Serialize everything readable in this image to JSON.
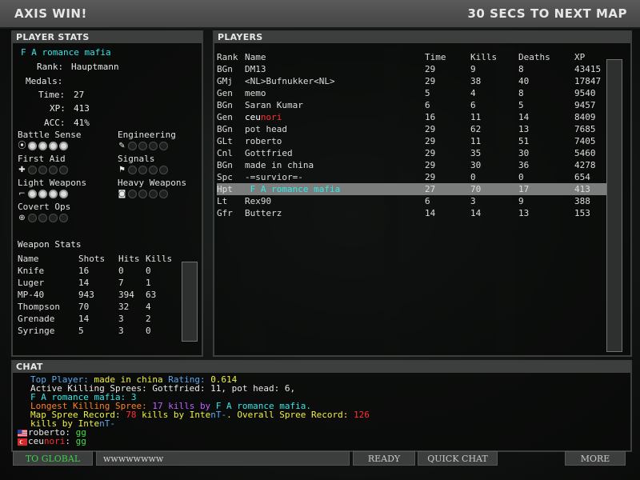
{
  "header": {
    "left": "AXIS WIN!",
    "right": "30 SECS TO NEXT MAP"
  },
  "player_stats": {
    "title": "PLAYER STATS",
    "name": "F A romance mafia",
    "rank_label": "Rank:",
    "rank": "Hauptmann",
    "medals_label": "Medals:",
    "time_label": "Time:",
    "time": "27",
    "xp_label": "XP:",
    "xp": "413",
    "acc_label": "ACC:",
    "acc": "41%",
    "skills": [
      {
        "name": "Battle Sense",
        "icon": "radio-wave-icon",
        "glyph": "((•))",
        "level": 4
      },
      {
        "name": "Engineering",
        "icon": "wrench-icon",
        "glyph": "✎",
        "level": 0
      },
      {
        "name": "First Aid",
        "icon": "medic-cross-icon",
        "glyph": "✚",
        "level": 0
      },
      {
        "name": "Signals",
        "icon": "signal-icon",
        "glyph": "⚑",
        "level": 0
      },
      {
        "name": "Light Weapons",
        "icon": "pistol-icon",
        "glyph": "⌐",
        "level": 4
      },
      {
        "name": "Heavy Weapons",
        "icon": "heavy-weapon-icon",
        "glyph": "◙",
        "level": 0
      },
      {
        "name": "Covert Ops",
        "icon": "crosshair-icon",
        "glyph": "⊕",
        "level": 0
      }
    ],
    "weapon_stats_title": "Weapon Stats",
    "weapon_headers": [
      "Name",
      "Shots",
      "Hits",
      "Kills"
    ],
    "weapons": [
      [
        "Knife",
        "16",
        "0",
        "0"
      ],
      [
        "Luger",
        "14",
        "7",
        "1"
      ],
      [
        "MP-40",
        "943",
        "394",
        "63"
      ],
      [
        "Thompson",
        "70",
        "32",
        "4"
      ],
      [
        "Grenade",
        "14",
        "3",
        "2"
      ],
      [
        "Syringe",
        "5",
        "3",
        "0"
      ]
    ]
  },
  "players": {
    "title": "PLAYERS",
    "headers": [
      "Rank",
      "Name",
      "Time",
      "Kills",
      "Deaths",
      "XP"
    ],
    "rows": [
      [
        "BGn",
        "DM13",
        "29",
        "9",
        "8",
        "43415"
      ],
      [
        "GMj",
        "<NL>Bufnukker<NL>",
        "29",
        "38",
        "40",
        "17847"
      ],
      [
        "Gen",
        "memo",
        "5",
        "4",
        "8",
        "9540"
      ],
      [
        "BGn",
        "Saran Kumar",
        "6",
        "6",
        "5",
        "9457"
      ],
      [
        "Gen",
        "ceunori",
        "16",
        "11",
        "14",
        "8409"
      ],
      [
        "BGn",
        "pot head",
        "29",
        "62",
        "13",
        "7685"
      ],
      [
        "GLt",
        "roberto",
        "29",
        "11",
        "51",
        "7405"
      ],
      [
        "Cnl",
        "Gottfried",
        "29",
        "35",
        "30",
        "5460"
      ],
      [
        "BGn",
        "made in china",
        "29",
        "30",
        "36",
        "4278"
      ],
      [
        "Spc",
        "-=survior=-",
        "29",
        "0",
        "0",
        "654"
      ],
      [
        "Hpt",
        "F A romance mafia",
        "27",
        "70",
        "17",
        "413"
      ],
      [
        "Lt",
        "Rex90",
        "6",
        "3",
        "9",
        "388"
      ],
      [
        "Gfr",
        "Butterz",
        "14",
        "14",
        "13",
        "153"
      ]
    ],
    "highlight_index": 10
  },
  "chat": {
    "title": "CHAT",
    "top_player_label": "Top Player:",
    "top_player": "made in china",
    "rating_label": "Rating:",
    "rating": "0.614",
    "active_sprees": "Active Killing Sprees: Gottfried: 11, pot head: 6,",
    "active_sprees_2": " F A romance mafia: 3",
    "longest_label": "Longest Killing Spree:",
    "longest_count": "17",
    "longest_mid": "kills by",
    "longest_name": " F A romance mafia.",
    "map_record_label": "Map Spree Record:",
    "map_record_count": "78",
    "map_record_mid": "kills by",
    "map_record_name_a": "Inte",
    "map_record_name_b": "nT-",
    "overall_label": "Overall Spree Record:",
    "overall_count": "126",
    "kills_by": "kills by",
    "overall_name_a": "Inte",
    "overall_name_b": "nT-",
    "msg1_name": "roberto:",
    "msg1_text": "gg",
    "msg2_name_a": "ceu",
    "msg2_name_b": "nori",
    "msg2_colon": ":",
    "msg2_text": "gg",
    "colors": {
      "blue": "#5aa8f0",
      "yellow": "#f0f040",
      "red": "#ff3030",
      "cyan": "#37e6e6",
      "orange": "#ff8020",
      "violet": "#c060ff",
      "green": "#40e040"
    }
  },
  "bottom": {
    "to_global": "TO GLOBAL",
    "chat_input": "wwwwwwww",
    "ready": "READY",
    "quick_chat": "QUICK CHAT",
    "more": "MORE"
  }
}
